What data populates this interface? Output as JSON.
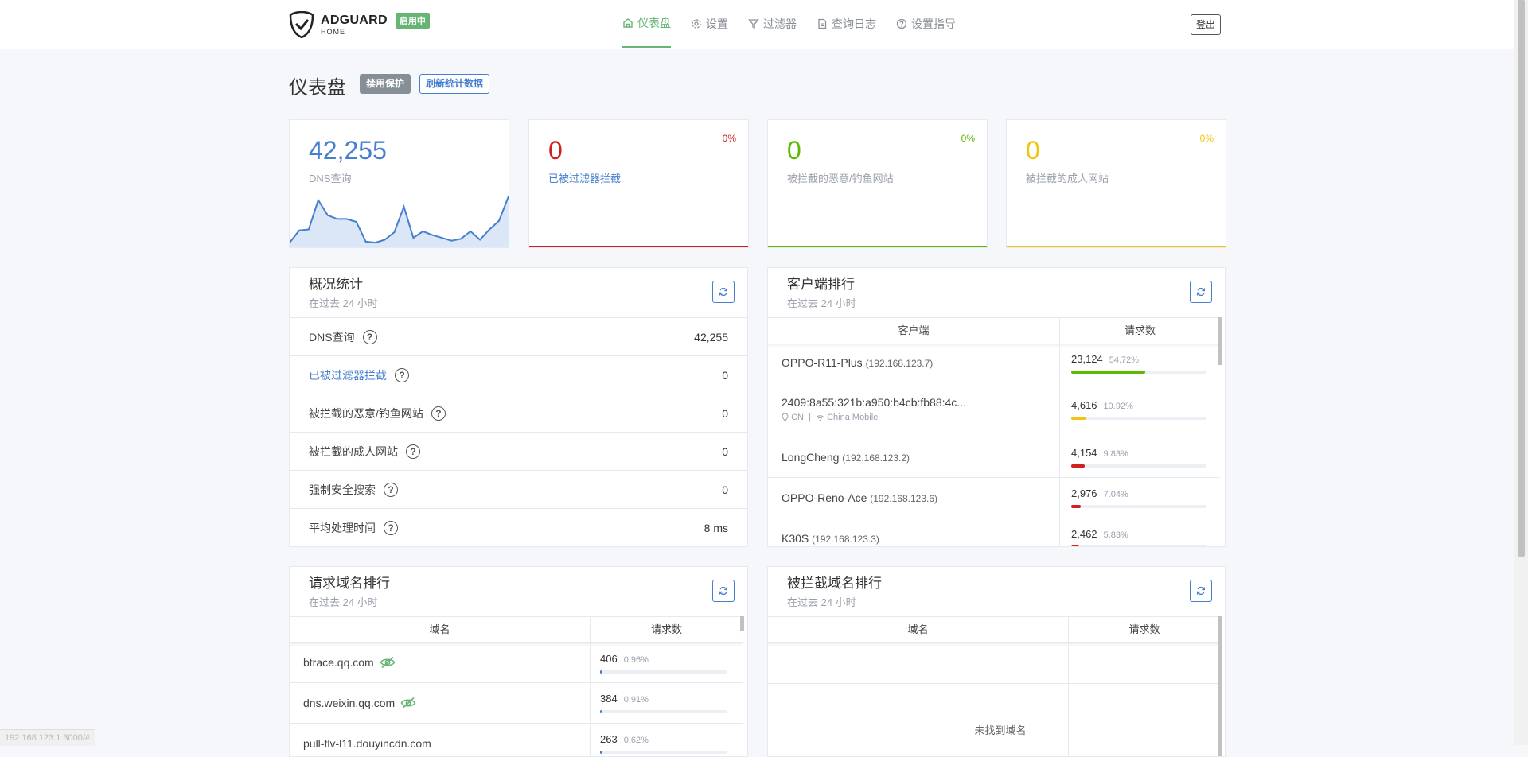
{
  "header": {
    "logo_main": "ADGUARD",
    "logo_sub": "HOME",
    "status_badge": "启用中",
    "nav": [
      {
        "label": "仪表盘",
        "icon": "home-icon",
        "active": true
      },
      {
        "label": "设置",
        "icon": "gear-icon",
        "active": false
      },
      {
        "label": "过滤器",
        "icon": "filter-icon",
        "active": false
      },
      {
        "label": "查询日志",
        "icon": "document-icon",
        "active": false
      },
      {
        "label": "设置指导",
        "icon": "help-circle-icon",
        "active": false
      }
    ],
    "logout_label": "登出"
  },
  "page": {
    "title": "仪表盘",
    "disable_protection_label": "禁用保护",
    "refresh_stats_label": "刷新统计数据"
  },
  "stats": [
    {
      "value": "42,255",
      "label": "DNS查询",
      "color": "#467fcf"
    },
    {
      "value": "0",
      "label": "已被过滤器拦截",
      "percent": "0%",
      "color": "#cd201f"
    },
    {
      "value": "0",
      "label": "被拦截的恶意/钓鱼网站",
      "percent": "0%",
      "color": "#5eba00"
    },
    {
      "value": "0",
      "label": "被拦截的成人网站",
      "percent": "0%",
      "color": "#f1c40f"
    }
  ],
  "sparkline": [
    5,
    18,
    19,
    50,
    34,
    30,
    30,
    27,
    6,
    5,
    8,
    16,
    43,
    10,
    17,
    13,
    10,
    7,
    9,
    17,
    8,
    19,
    28,
    54
  ],
  "overview": {
    "title": "概况统计",
    "subtitle": "在过去 24 小时",
    "rows": [
      {
        "label": "DNS查询",
        "value": "42,255",
        "link": false
      },
      {
        "label": "已被过滤器拦截",
        "value": "0",
        "link": true
      },
      {
        "label": "被拦截的恶意/钓鱼网站",
        "value": "0",
        "link": false
      },
      {
        "label": "被拦截的成人网站",
        "value": "0",
        "link": false
      },
      {
        "label": "强制安全搜索",
        "value": "0",
        "link": false
      },
      {
        "label": "平均处理时间",
        "value": "8 ms",
        "link": false
      }
    ]
  },
  "clients": {
    "title": "客户端排行",
    "subtitle": "在过去 24 小时",
    "col_client": "客户端",
    "col_requests": "请求数",
    "rows": [
      {
        "name": "OPPO-R11-Plus",
        "ip": "(192.168.123.7)",
        "count": "23,124",
        "percent": "54.72%",
        "fraction": 0.5472,
        "color": "#5eba00"
      },
      {
        "name": "2409:8a55:321b:a950:b4cb:fb88:4c...",
        "ip": "",
        "country": "CN",
        "isp": "China Mobile",
        "count": "4,616",
        "percent": "10.92%",
        "fraction": 0.1092,
        "color": "#f1c40f"
      },
      {
        "name": "LongCheng",
        "ip": "(192.168.123.2)",
        "count": "4,154",
        "percent": "9.83%",
        "fraction": 0.0983,
        "color": "#cd201f"
      },
      {
        "name": "OPPO-Reno-Ace",
        "ip": "(192.168.123.6)",
        "count": "2,976",
        "percent": "7.04%",
        "fraction": 0.0704,
        "color": "#cd201f"
      },
      {
        "name": "K30S",
        "ip": "(192.168.123.3)",
        "count": "2,462",
        "percent": "5.83%",
        "fraction": 0.0583,
        "color": "#cd201f"
      }
    ]
  },
  "domains": {
    "title": "请求域名排行",
    "subtitle": "在过去 24 小时",
    "col_domain": "域名",
    "col_requests": "请求数",
    "rows": [
      {
        "domain": "btrace.qq.com",
        "count": "406",
        "percent": "0.96%",
        "fraction": 0.0096
      },
      {
        "domain": "dns.weixin.qq.com",
        "count": "384",
        "percent": "0.91%",
        "fraction": 0.0091
      },
      {
        "domain": "pull-flv-l11.douyincdn.com",
        "count": "263",
        "percent": "0.62%",
        "fraction": 0.0062
      }
    ]
  },
  "blocked": {
    "title": "被拦截域名排行",
    "subtitle": "在过去 24 小时",
    "col_domain": "域名",
    "col_requests": "请求数",
    "empty_message": "未找到域名"
  },
  "status_url": "192.168.123.1:3000/#"
}
